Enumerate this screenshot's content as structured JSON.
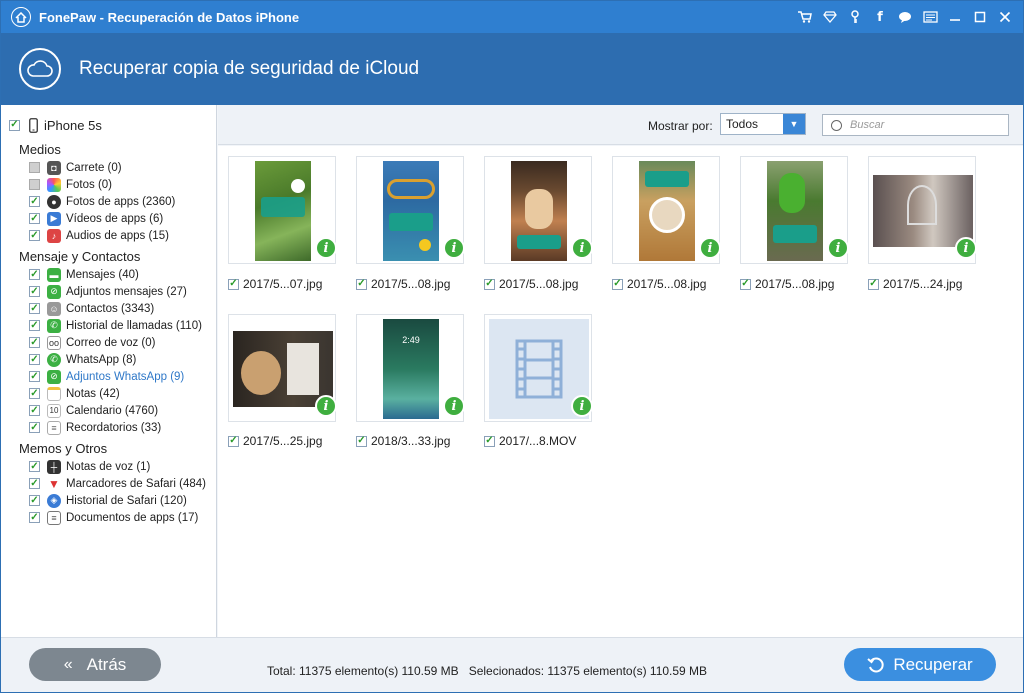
{
  "window": {
    "title": "FonePaw - Recuperación de Datos iPhone"
  },
  "banner": {
    "title": "Recuperar copia de seguridad de iCloud"
  },
  "sidebar": {
    "device": "iPhone 5s",
    "groups": [
      {
        "label": "Medios",
        "items": [
          {
            "label": "Carrete (0)",
            "checked": false,
            "color": "#555"
          },
          {
            "label": "Fotos (0)",
            "checked": false,
            "color": "#e77"
          },
          {
            "label": "Fotos de apps (2360)",
            "checked": true,
            "color": "#333"
          },
          {
            "label": "Vídeos de apps (6)",
            "checked": true,
            "color": "#3a7bd5"
          },
          {
            "label": "Audios de apps (15)",
            "checked": true,
            "color": "#d44"
          }
        ]
      },
      {
        "label": "Mensaje y Contactos",
        "items": [
          {
            "label": "Mensajes (40)",
            "checked": true,
            "color": "#3cb043"
          },
          {
            "label": "Adjuntos mensajes (27)",
            "checked": true,
            "color": "#3cb043"
          },
          {
            "label": "Contactos (3343)",
            "checked": true,
            "color": "#999"
          },
          {
            "label": "Historial de llamadas (110)",
            "checked": true,
            "color": "#3cb043"
          },
          {
            "label": "Correo de voz (0)",
            "checked": true,
            "color": "#666"
          },
          {
            "label": "WhatsApp (8)",
            "checked": true,
            "color": "#3cb043"
          },
          {
            "label": "Adjuntos WhatsApp (9)",
            "checked": true,
            "color": "#3cb043",
            "selected": true
          },
          {
            "label": "Notas (42)",
            "checked": true,
            "color": "#f0c040"
          },
          {
            "label": "Calendario (4760)",
            "checked": true,
            "color": "#ccc"
          },
          {
            "label": "Recordatorios (33)",
            "checked": true,
            "color": "#aaa"
          }
        ]
      },
      {
        "label": "Memos y Otros",
        "items": [
          {
            "label": "Notas de voz (1)",
            "checked": true,
            "color": "#333"
          },
          {
            "label": "Marcadores de Safari (484)",
            "checked": true,
            "color": "#d33"
          },
          {
            "label": "Historial de Safari (120)",
            "checked": true,
            "color": "#3a7bd5"
          },
          {
            "label": "Documentos de apps (17)",
            "checked": true,
            "color": "#777"
          }
        ]
      }
    ]
  },
  "toolbar": {
    "show_label": "Mostrar por:",
    "show_value": "Todos",
    "search_placeholder": "Buscar"
  },
  "files": [
    {
      "name": "2017/5...07.jpg",
      "checked": true
    },
    {
      "name": "2017/5...08.jpg",
      "checked": true
    },
    {
      "name": "2017/5...08.jpg",
      "checked": true
    },
    {
      "name": "2017/5...08.jpg",
      "checked": true
    },
    {
      "name": "2017/5...08.jpg",
      "checked": true
    },
    {
      "name": "2017/5...24.jpg",
      "checked": true
    },
    {
      "name": "2017/5...25.jpg",
      "checked": true
    },
    {
      "name": "2018/3...33.jpg",
      "checked": true
    },
    {
      "name": "2017/...8.MOV",
      "checked": true
    }
  ],
  "footer": {
    "back_label": "Atrás",
    "total": "Total: 11375 elemento(s) 110.59 MB",
    "selected": "Selecionados: 11375 elemento(s) 110.59 MB",
    "recover_label": "Recuperar"
  },
  "colors": {
    "titlebar": "#2f7fd0",
    "banner": "#2d6db0",
    "check": "#2a9a2a",
    "info_badge": "#3fae3f",
    "recover": "#3b8fe0"
  }
}
